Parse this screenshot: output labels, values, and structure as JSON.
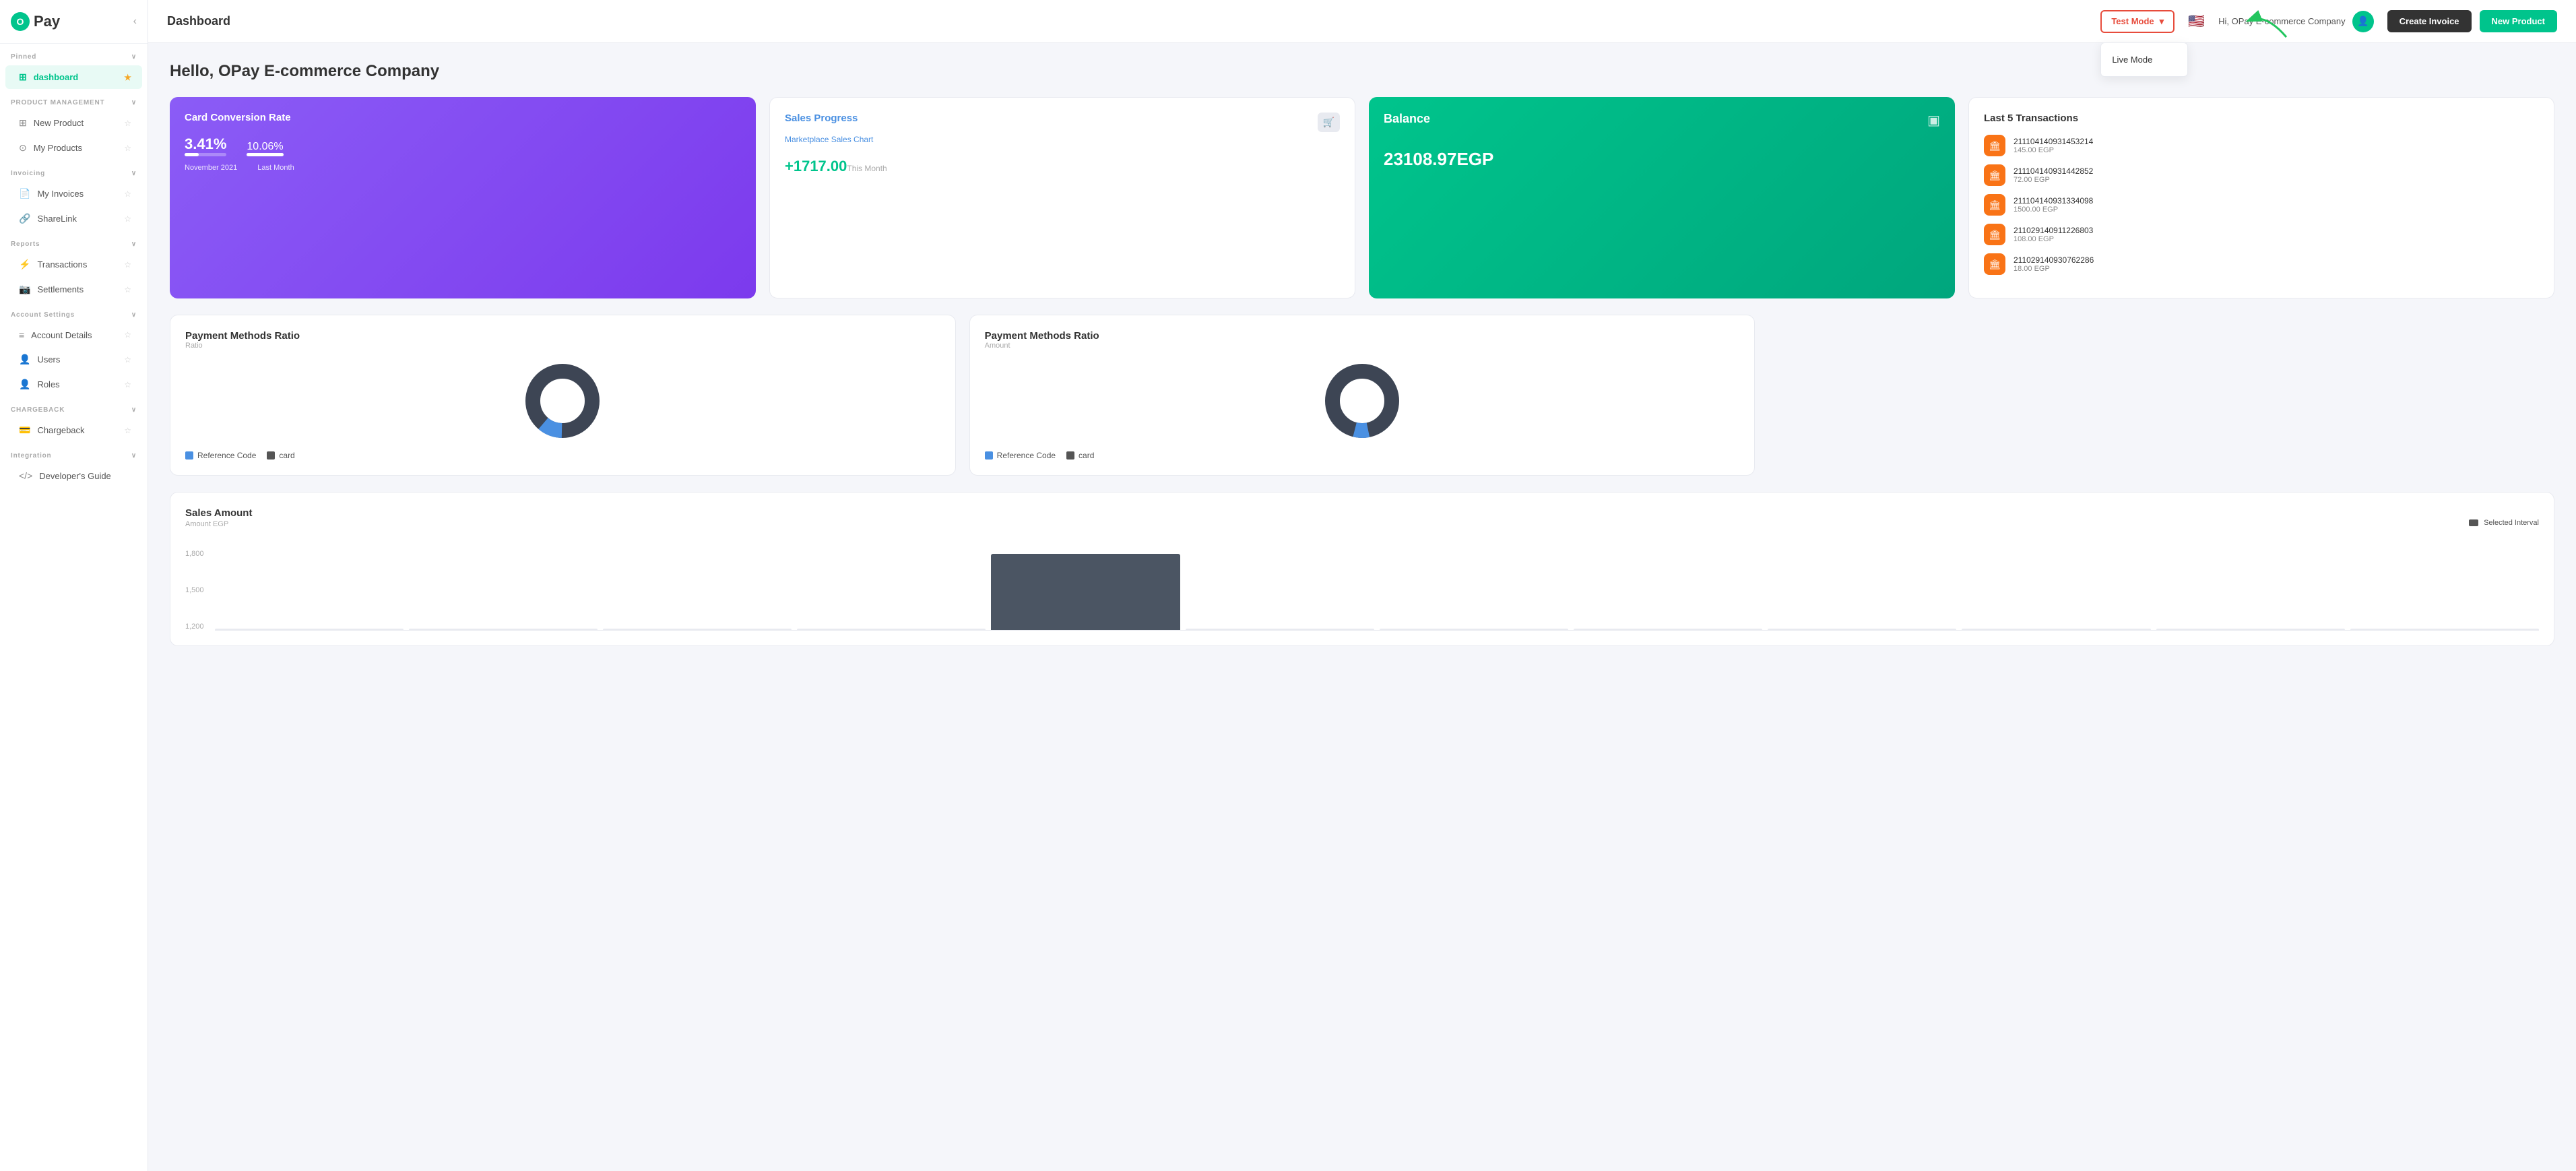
{
  "logo": {
    "letter": "O",
    "name": "Pay"
  },
  "sidebar": {
    "pinned_label": "Pinned",
    "product_management_label": "PRODUCT MANAGEMENT",
    "invoicing_label": "Invoicing",
    "reports_label": "Reports",
    "account_settings_label": "Account Settings",
    "chargeback_label": "CHARGEBACK",
    "integration_label": "Integration",
    "items": [
      {
        "id": "dashboard",
        "label": "dashboard",
        "icon": "⊞",
        "active": true
      },
      {
        "id": "new-product",
        "label": "New Product",
        "icon": "⊞"
      },
      {
        "id": "my-products",
        "label": "My Products",
        "icon": "⊙"
      },
      {
        "id": "my-invoices",
        "label": "My Invoices",
        "icon": "📄"
      },
      {
        "id": "sharelink",
        "label": "ShareLink",
        "icon": "🔗"
      },
      {
        "id": "transactions",
        "label": "Transactions",
        "icon": "⚡"
      },
      {
        "id": "settlements",
        "label": "Settlements",
        "icon": "📷"
      },
      {
        "id": "account-details",
        "label": "Account Details",
        "icon": "≡"
      },
      {
        "id": "users",
        "label": "Users",
        "icon": "👤"
      },
      {
        "id": "roles",
        "label": "Roles",
        "icon": "👤"
      },
      {
        "id": "chargeback",
        "label": "Chargeback",
        "icon": "💳"
      },
      {
        "id": "developers-guide",
        "label": "Developer's Guide",
        "icon": "</>"
      }
    ]
  },
  "topbar": {
    "title": "Dashboard",
    "test_mode_label": "Test Mode",
    "live_mode_label": "Live Mode",
    "user_greeting": "Hi, OPay E-commerce Company",
    "create_invoice_label": "Create Invoice",
    "new_product_label": "New Product"
  },
  "dashboard": {
    "hello": "Hello, OPay E-commerce Company",
    "card_conversion": {
      "title": "Card Conversion Rate",
      "value1": "3.41%",
      "value2": "10.06%",
      "progress1": 34,
      "progress2": 100,
      "label1": "November 2021",
      "label2": "Last Month"
    },
    "sales_progress": {
      "title": "Sales Progress",
      "subtitle": "Marketplace Sales Chart",
      "value": "+1717.00",
      "period": "This Month",
      "icon": "🛒"
    },
    "balance": {
      "title": "Balance",
      "value": "23108.97EGP",
      "icon": "💳"
    },
    "last_transactions": {
      "title": "Last 5 Transactions",
      "items": [
        {
          "id": "211104140931453214",
          "amount": "145.00 EGP"
        },
        {
          "id": "211104140931442852",
          "amount": "72.00 EGP"
        },
        {
          "id": "211104140931334098",
          "amount": "1500.00 EGP"
        },
        {
          "id": "211029140911226803",
          "amount": "108.00 EGP"
        },
        {
          "id": "211029140930762286",
          "amount": "18.00 EGP"
        }
      ]
    },
    "payment_ratio_1": {
      "title": "Payment Methods Ratio",
      "subtitle": "Ratio",
      "legend": [
        {
          "color": "#4a90e2",
          "label": "Reference Code"
        },
        {
          "color": "#555",
          "label": "card"
        }
      ]
    },
    "payment_ratio_2": {
      "title": "Payment Methods Ratio",
      "subtitle": "Amount",
      "legend": [
        {
          "color": "#4a90e2",
          "label": "Reference Code"
        },
        {
          "color": "#555",
          "label": "card"
        }
      ]
    },
    "sales_amount": {
      "title": "Sales Amount",
      "subtitle": "Amount EGP",
      "legend_label": "Selected Interval",
      "y_labels": [
        "1,800",
        "1,500",
        "1,200"
      ],
      "bar_data": [
        0,
        0,
        0,
        0,
        1717,
        0,
        0,
        0,
        0,
        0,
        0,
        0
      ]
    }
  }
}
